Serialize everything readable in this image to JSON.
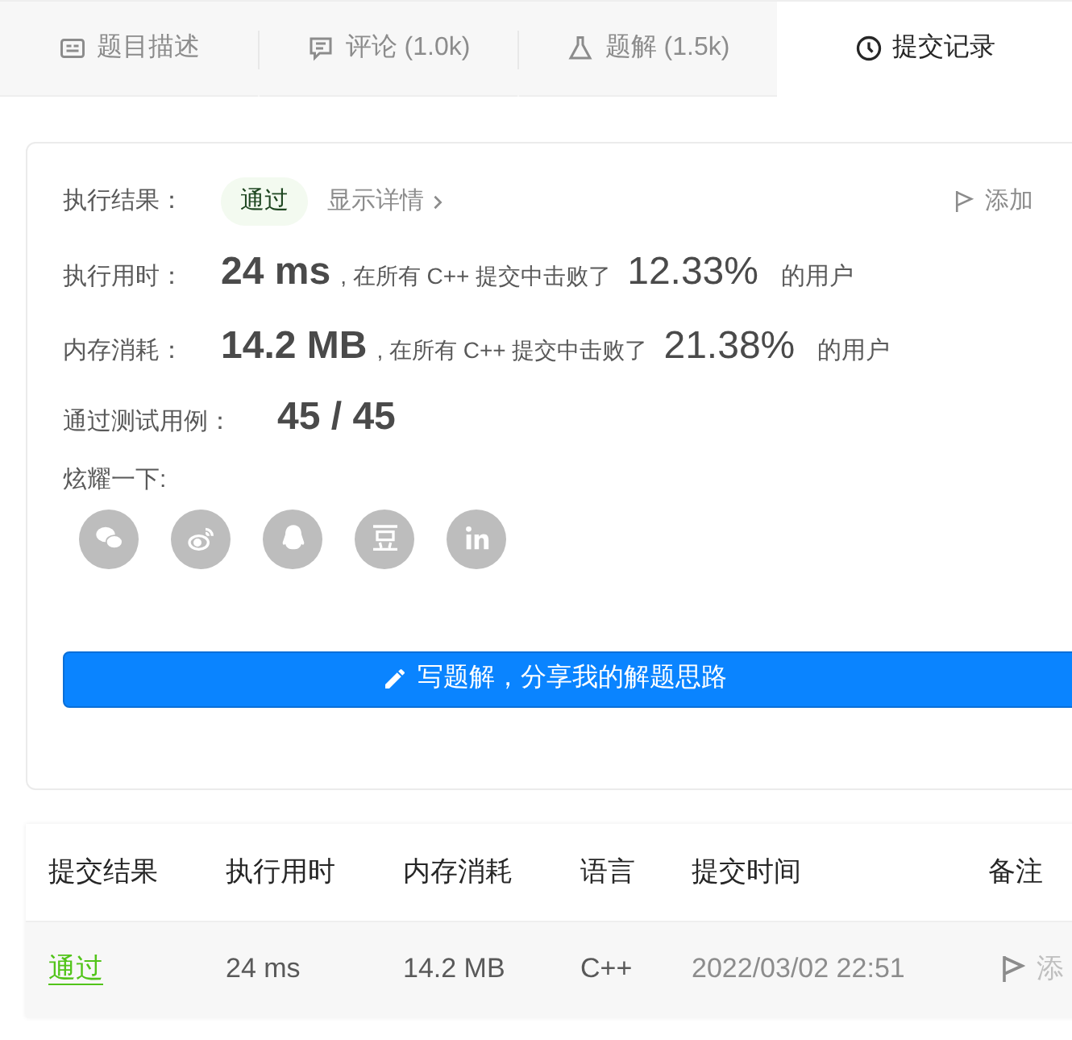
{
  "tabs": [
    {
      "label": "题目描述",
      "kind": "description",
      "selected": false
    },
    {
      "label": "评论 (1.0k)",
      "kind": "comment",
      "selected": false
    },
    {
      "label": "题解 (1.5k)",
      "kind": "flask",
      "selected": false
    },
    {
      "label": "提交记录",
      "kind": "clock",
      "selected": true
    }
  ],
  "result": {
    "label": "执行结果：",
    "status": "通过",
    "details_link": "显示详情",
    "note_link": "添加"
  },
  "stats": [
    {
      "label": "执行用时：",
      "value": "24 ms",
      "middle": ", 在所有 C++ 提交中击败了",
      "percent": "12.33%",
      "suffix": "的用户"
    },
    {
      "label": "内存消耗：",
      "value": "14.2 MB",
      "middle": ", 在所有 C++ 提交中击败了",
      "percent": "21.38%",
      "suffix": "的用户"
    }
  ],
  "tests": {
    "label": "通过测试用例：",
    "value": "45 / 45"
  },
  "share": {
    "label": "炫耀一下:",
    "icons": [
      {
        "kind": "wechat"
      },
      {
        "kind": "weibo"
      },
      {
        "kind": "qq"
      },
      {
        "kind": "douban"
      },
      {
        "kind": "linkedin"
      }
    ]
  },
  "write_button": "写题解，分享我的解题思路",
  "table": {
    "columns": [
      "提交结果",
      "执行用时",
      "内存消耗",
      "语言",
      "提交时间",
      "备注"
    ],
    "rows": [
      {
        "status": "通过",
        "time": "24 ms",
        "memory": "14.2 MB",
        "language": "C++",
        "submitted": "2022/03/02 22:51",
        "note": "添"
      }
    ]
  }
}
